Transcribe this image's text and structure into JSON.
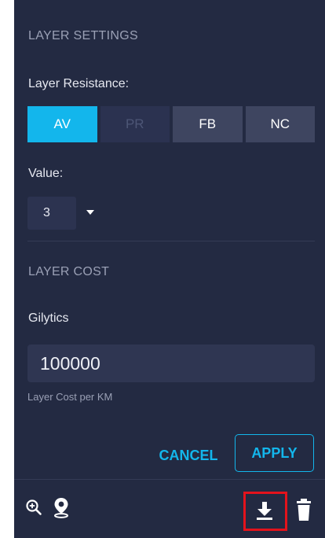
{
  "layer_settings": {
    "section_title": "LAYER SETTINGS",
    "resistance_label": "Layer Resistance:",
    "resistance_options": [
      {
        "label": "AV",
        "state": "active"
      },
      {
        "label": "PR",
        "state": "disabled"
      },
      {
        "label": "FB",
        "state": "normal"
      },
      {
        "label": "NC",
        "state": "normal"
      }
    ],
    "value_label": "Value:",
    "value_selected": "3"
  },
  "layer_cost": {
    "section_title": "LAYER COST",
    "provider_label": "Gilytics",
    "cost_value": "100000",
    "cost_helper": "Layer Cost per KM"
  },
  "actions": {
    "cancel_label": "CANCEL",
    "apply_label": "APPLY"
  },
  "footer_icons": {
    "left": [
      "zoom-in-icon",
      "location-pin-icon"
    ],
    "right": [
      "download-icon",
      "trash-icon"
    ]
  },
  "colors": {
    "panel_bg": "#232a42",
    "accent": "#13b6ec",
    "highlight": "#e3131c"
  }
}
